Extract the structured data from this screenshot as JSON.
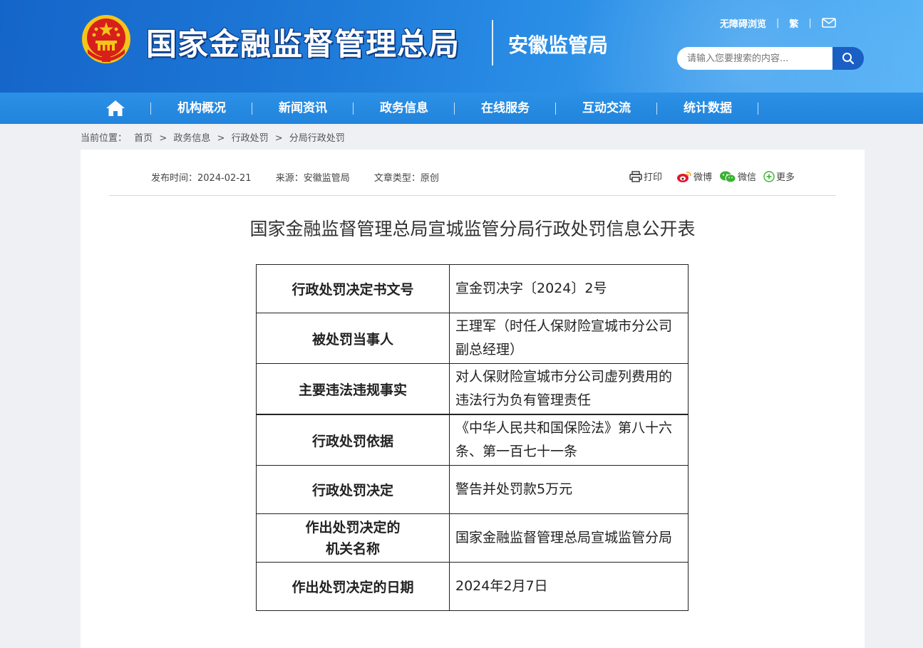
{
  "header": {
    "site_title": "国家金融监督管理总局",
    "sub_title": "安徽监管局",
    "accessibility_link": "无障碍浏览",
    "traditional_link": "繁",
    "search_placeholder": "请输入您要搜索的内容..."
  },
  "nav": {
    "items": [
      "机构概况",
      "新闻资讯",
      "政务信息",
      "在线服务",
      "互动交流",
      "统计数据"
    ]
  },
  "breadcrumb": {
    "label": "当前位置：",
    "items": [
      "首页",
      "政务信息",
      "行政处罚",
      "分局行政处罚"
    ],
    "separator": ">"
  },
  "article": {
    "publish_time": "发布时间：2024-02-21",
    "source": "来源：安徽监管局",
    "type": "文章类型：原创",
    "share": {
      "print": "打印",
      "weibo": "微博",
      "wechat": "微信",
      "more": "更多"
    },
    "title": "国家金融监督管理总局宣城监管分局行政处罚信息公开表"
  },
  "table": {
    "rows": [
      {
        "key": "行政处罚决定书文号",
        "value": "宣金罚决字〔2024〕2号"
      },
      {
        "key": "被处罚当事人",
        "value": "王理军（时任人保财险宣城市分公司副总经理）"
      },
      {
        "key": "主要违法违规事实",
        "value": "对人保财险宣城市分公司虚列费用的违法行为负有管理责任"
      },
      {
        "key": "行政处罚依据",
        "value": "《中华人民共和国保险法》第八十六条、第一百七十一条"
      },
      {
        "key": "行政处罚决定",
        "value": "警告并处罚款5万元"
      },
      {
        "key": "作出处罚决定的机关名称",
        "key_line1": "作出处罚决定的",
        "key_line2": "机关名称",
        "value": "国家金融监督管理总局宣城监管分局"
      },
      {
        "key": "作出处罚决定的日期",
        "value": "2024年2月7日"
      }
    ]
  },
  "colors": {
    "header_blue": "#1e7ad8",
    "nav_blue": "#2284dc",
    "search_button": "#1a5fc4",
    "emblem_red": "#d7201b",
    "emblem_gold": "#f5c518",
    "wechat_green": "#3cb034",
    "weibo_red": "#e6162d"
  }
}
